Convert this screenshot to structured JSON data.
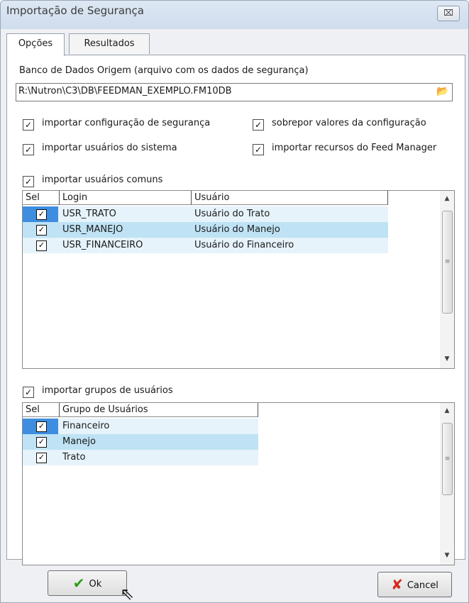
{
  "window": {
    "title": "Importação de Segurança",
    "close_label": "⌧"
  },
  "tabs": [
    {
      "label": "Opções"
    },
    {
      "label": "Resultados"
    }
  ],
  "source_db": {
    "label": "Banco de Dados Origem (arquivo com os dados de segurança)",
    "value": "R:\\Nutron\\C3\\DB\\FEEDMAN_EXEMPLO.FM10DB",
    "browse_icon": "folder-open-icon"
  },
  "options": {
    "import_security_config": {
      "label": "importar configuração de segurança",
      "checked": true
    },
    "overwrite_config": {
      "label": "sobrepor valores da configuração",
      "checked": true
    },
    "import_system_users": {
      "label": "importar usuários do sistema",
      "checked": true
    },
    "import_feed_manager_resources": {
      "label": "importar recursos do Feed Manager",
      "checked": true
    },
    "import_common_users": {
      "label": "importar usuários comuns",
      "checked": true
    },
    "import_user_groups": {
      "label": "importar grupos de usuários",
      "checked": true
    }
  },
  "users_table": {
    "columns": [
      "Sel",
      "Login",
      "Usuário"
    ],
    "rows": [
      {
        "login": "USR_TRATO",
        "usuario": "Usuário do Trato",
        "selected": true
      },
      {
        "login": "USR_MANEJO",
        "usuario": "Usuário do Manejo",
        "selected": true
      },
      {
        "login": "USR_FINANCEIRO",
        "usuario": "Usuário do Financeiro",
        "selected": true
      }
    ]
  },
  "groups_table": {
    "columns": [
      "Sel",
      "Grupo de Usuários"
    ],
    "rows": [
      {
        "grupo": "Financeiro",
        "selected": true
      },
      {
        "grupo": "Manejo",
        "selected": true
      },
      {
        "grupo": "Trato",
        "selected": true
      }
    ]
  },
  "buttons": {
    "ok_label": "Ok",
    "cancel_label": "Cancel"
  },
  "colors": {
    "row_light": "#e6f3fb",
    "row_dark": "#bfe3f5",
    "selection": "#3d8ee0",
    "ok_icon": "#2c9c18",
    "cancel_icon": "#d32a1f"
  }
}
